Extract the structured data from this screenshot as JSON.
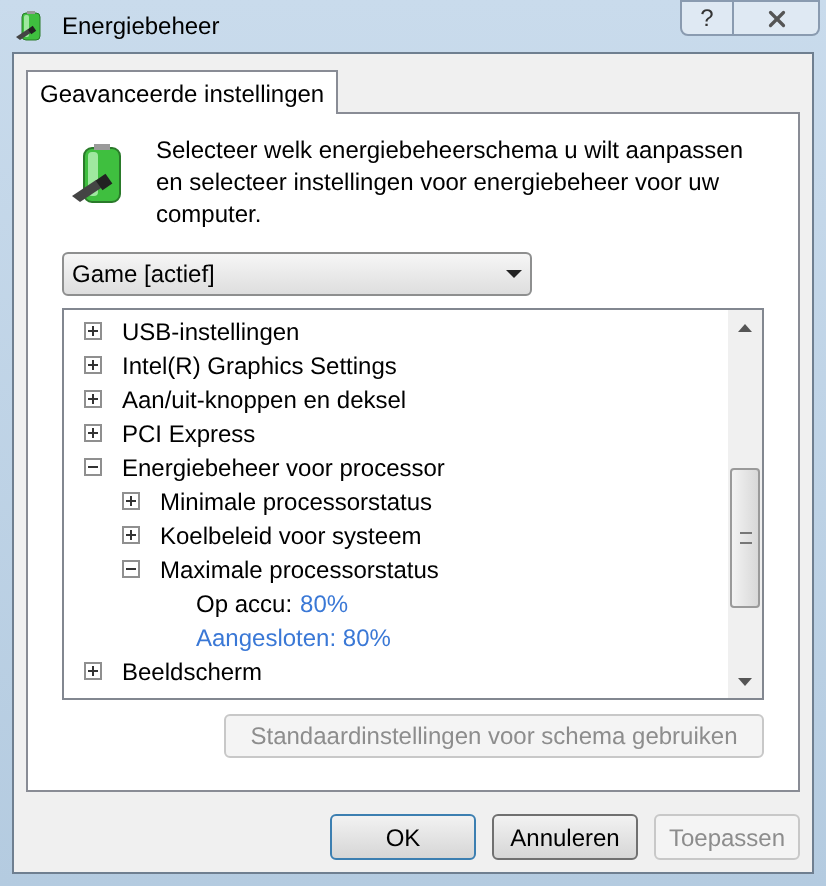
{
  "window": {
    "title": "Energiebeheer",
    "help": "?"
  },
  "tabs": [
    {
      "label": "Geavanceerde instellingen",
      "selected": true
    }
  ],
  "intro": "Selecteer welk energiebeheerschema u wilt aanpassen en selecteer instellingen voor energiebeheer voor uw computer.",
  "plan_select": {
    "value": "Game [actief]"
  },
  "tree": [
    {
      "label": "USB-instellingen",
      "expanded": false
    },
    {
      "label": "Intel(R) Graphics Settings",
      "expanded": false
    },
    {
      "label": "Aan/uit-knoppen en deksel",
      "expanded": false
    },
    {
      "label": "PCI Express",
      "expanded": false
    },
    {
      "label": "Energiebeheer voor processor",
      "expanded": true,
      "children": [
        {
          "label": "Minimale processorstatus",
          "expanded": false
        },
        {
          "label": "Koelbeleid voor systeem",
          "expanded": false
        },
        {
          "label": "Maximale processorstatus",
          "expanded": true,
          "children": [
            {
              "kind": "setting",
              "label": "Op accu:",
              "value": "80%",
              "selected": false
            },
            {
              "kind": "setting",
              "label": "Aangesloten:",
              "value": "80%",
              "selected": true
            }
          ]
        }
      ]
    },
    {
      "label": "Beeldscherm",
      "expanded": false
    }
  ],
  "defaults_button": {
    "label": "Standaardinstellingen voor schema gebruiken",
    "disabled": true
  },
  "buttons": [
    {
      "label": "OK",
      "disabled": false,
      "default": true
    },
    {
      "label": "Annuleren",
      "disabled": false,
      "default": false
    },
    {
      "label": "Toepassen",
      "disabled": true,
      "default": false
    }
  ]
}
